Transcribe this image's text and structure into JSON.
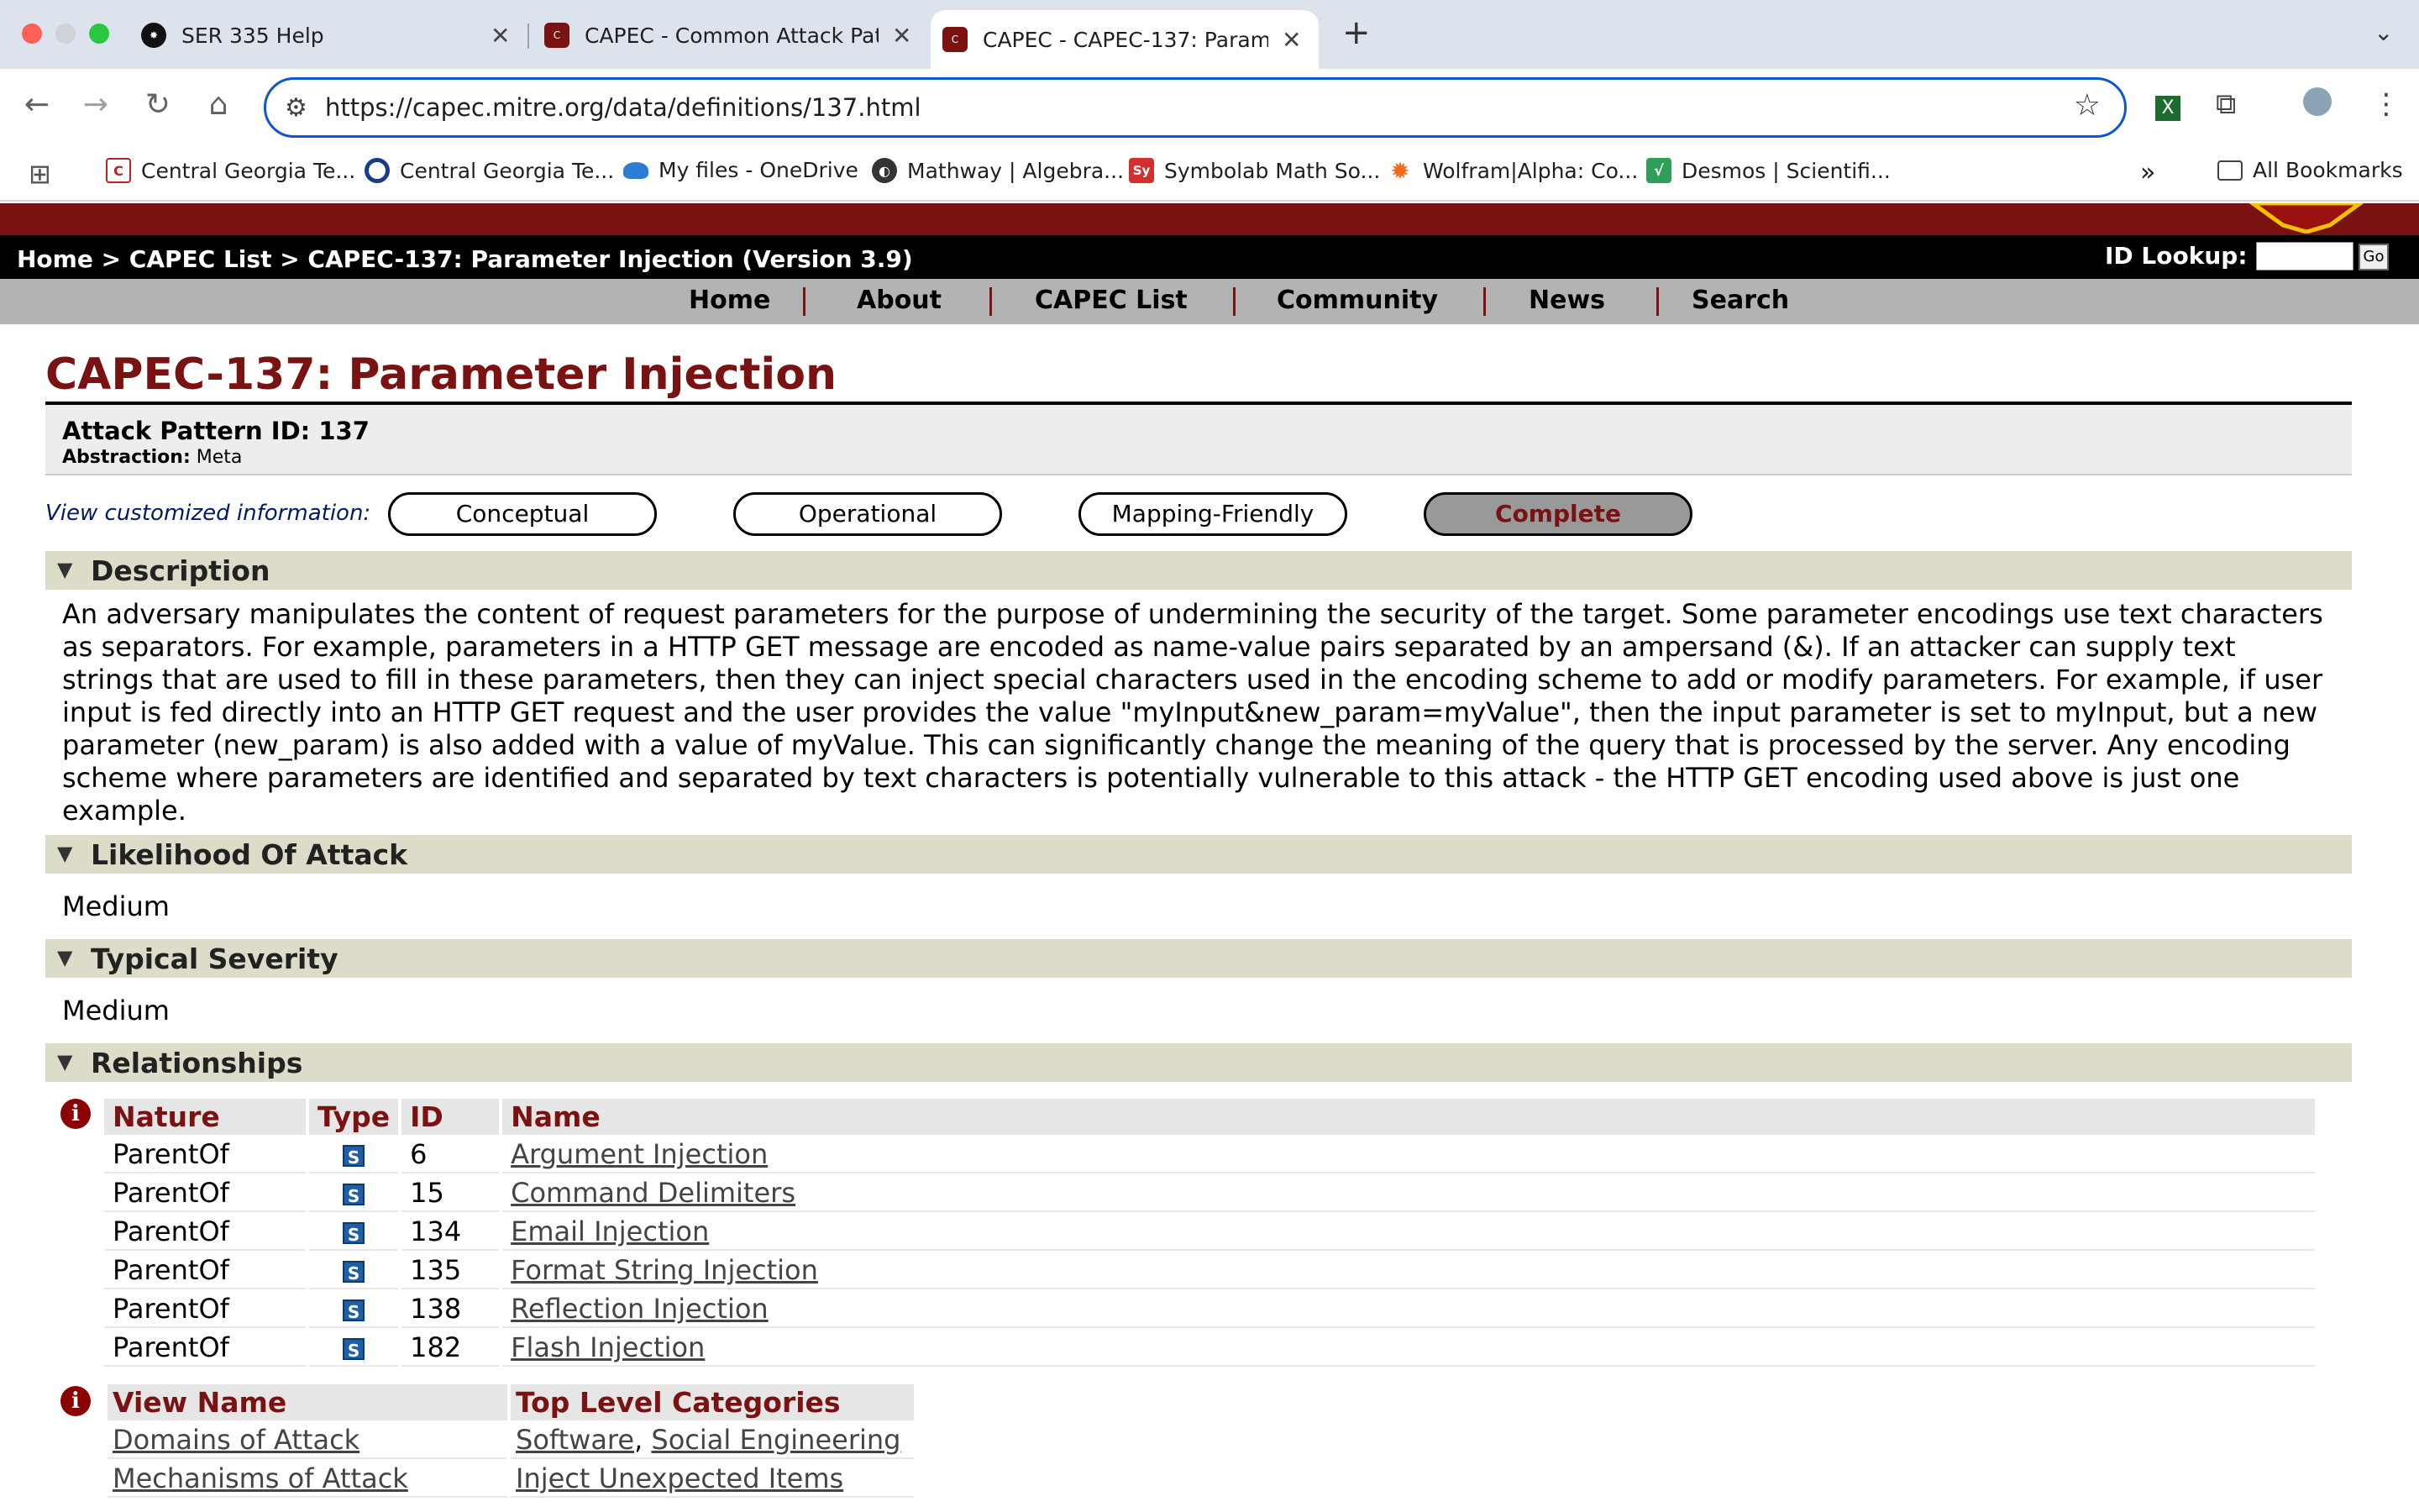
{
  "browser": {
    "tabs": [
      {
        "title": "SER 335 Help",
        "icon": "chatgpt-icon"
      },
      {
        "title": "CAPEC - Common Attack Patt",
        "icon": "capec-icon"
      },
      {
        "title": "CAPEC - CAPEC-137: Parame",
        "icon": "capec-icon"
      }
    ],
    "url": "https://capec.mitre.org/data/definitions/137.html",
    "bookmarks": [
      "Central Georgia Te...",
      "Central Georgia Te...",
      "My files - OneDrive",
      "Mathway | Algebra...",
      "Symbolab Math So...",
      "Wolfram|Alpha: Co...",
      "Desmos | Scientifi..."
    ],
    "all_bookmarks": "All Bookmarks",
    "accent_color": "#0b57d0"
  },
  "site": {
    "breadcrumb": "Home > CAPEC List > CAPEC-137: Parameter Injection (Version 3.9)",
    "id_lookup_label": "ID Lookup:",
    "go_label": "Go",
    "menu": [
      "Home",
      "About",
      "CAPEC List",
      "Community",
      "News",
      "Search"
    ],
    "brand_color": "#7a1212"
  },
  "page": {
    "title": "CAPEC-137: Parameter Injection",
    "attack_pattern_id": "Attack Pattern ID: 137",
    "abstraction_label": "Abstraction:",
    "abstraction_value": "Meta",
    "view_label": "View customized information:",
    "view_buttons": [
      "Conceptual",
      "Operational",
      "Mapping-Friendly",
      "Complete"
    ],
    "selected_view": "Complete",
    "sections": {
      "description": {
        "heading": "Description",
        "lines": [
          "An adversary manipulates the content of request parameters for the purpose of undermining the security of the target. Some parameter encodings use text characters",
          "as separators. For example, parameters in a HTTP GET message are encoded as name-value pairs separated by an ampersand (&). If an attacker can supply text",
          "strings that are used to fill in these parameters, then they can inject special characters used in the encoding scheme to add or modify parameters. For example, if user",
          "input is fed directly into an HTTP GET request and the user provides the value \"myInput&new_param=myValue\", then the input parameter is set to myInput, but a new",
          "parameter (new_param) is also added with a value of myValue. This can significantly change the meaning of the query that is processed by the server. Any encoding",
          "scheme where parameters are identified and separated by text characters is potentially vulnerable to this attack - the HTTP GET encoding used above is just one",
          "example."
        ]
      },
      "likelihood": {
        "heading": "Likelihood Of Attack",
        "value": "Medium"
      },
      "severity": {
        "heading": "Typical Severity",
        "value": "Medium"
      },
      "relationships": {
        "heading": "Relationships",
        "columns": [
          "Nature",
          "Type",
          "ID",
          "Name"
        ],
        "rows": [
          {
            "nature": "ParentOf",
            "type": "S",
            "id": "6",
            "name": "Argument Injection"
          },
          {
            "nature": "ParentOf",
            "type": "S",
            "id": "15",
            "name": "Command Delimiters"
          },
          {
            "nature": "ParentOf",
            "type": "S",
            "id": "134",
            "name": "Email Injection"
          },
          {
            "nature": "ParentOf",
            "type": "S",
            "id": "135",
            "name": "Format String Injection"
          },
          {
            "nature": "ParentOf",
            "type": "S",
            "id": "138",
            "name": "Reflection Injection"
          },
          {
            "nature": "ParentOf",
            "type": "S",
            "id": "182",
            "name": "Flash Injection"
          }
        ],
        "views_columns": [
          "View Name",
          "Top Level Categories"
        ],
        "views_rows": [
          {
            "view": "Domains of Attack",
            "categories": [
              "Software",
              "Social Engineering"
            ]
          },
          {
            "view": "Mechanisms of Attack",
            "categories": [
              "Inject Unexpected Items"
            ]
          }
        ]
      }
    }
  }
}
